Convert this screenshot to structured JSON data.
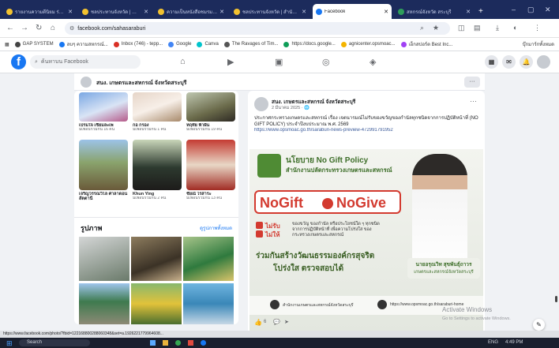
{
  "browser": {
    "tabs": [
      {
        "label": "รายงานความดีนิยม ร่วมขับเคลื่อน"
      },
      {
        "label": "ชลประทานจังหวัด | สำนักงานฯ"
      },
      {
        "label": "ความเป็นหนังสือชมรมสหกรณ์"
      },
      {
        "label": "ชลประทานจังหวัด | สำนักงานฯ"
      },
      {
        "label": "Facebook"
      },
      {
        "label": "สหกรณ์จังหวัด สระบุรี"
      }
    ],
    "new_tab_label": "+",
    "url": "facebook.com/sahasaraburi",
    "bookmarks": [
      {
        "label": "GAP SYSTEM"
      },
      {
        "label": "ลบๆ ความสหกรณ์..."
      },
      {
        "label": "Inbox (746) - tepp..."
      },
      {
        "label": "Google"
      },
      {
        "label": "Canva"
      },
      {
        "label": "The Ravages of Tim..."
      },
      {
        "label": "https://docs.google..."
      },
      {
        "label": "agnicenter.opsmoac..."
      },
      {
        "label": "เอ็กสปอร์ต Best Inc..."
      },
      {
        "label": "บุ๊กมาร์กทั้งหมด"
      }
    ]
  },
  "facebook": {
    "logo": "f",
    "search_placeholder": "ค้นหาบน Facebook"
  },
  "page_header": {
    "name": "สนง. เกษตรและสหกรณ์ จังหวัดสระบุรี",
    "more": "···"
  },
  "friends": [
    {
      "name": "เปรมใจ เชียมละเพ",
      "mutual": "มีเพื่อนร่วมกัน 16 คน"
    },
    {
      "name": "กอ กรอง",
      "mutual": "มีเพื่อนร่วมกัน 1 คน"
    },
    {
      "name": "หฤทัย ฟ้าฝัน",
      "mutual": "มีเพื่อนร่วมกัน 19 คน"
    },
    {
      "name": "เจริญวรรณวิไล ศาลาดอน สัตตานี",
      "mutual": ""
    },
    {
      "name": "Khun Ying",
      "mutual": "มีเพื่อนร่วมกัน 2 คน"
    },
    {
      "name": "ชัยณ์ ไรสาระ",
      "mutual": "มีเพื่อนร่วมกัน 13 คน"
    }
  ],
  "photos": {
    "title": "รูปภาพ",
    "see_all": "ดูรูปภาพทั้งหมด"
  },
  "post": {
    "author": "สนง. เกษตรและสหกรณ์ จังหวัดสระบุรี",
    "time": "2 มีนาคม 2025 · 🌐",
    "more": "···",
    "text": "ประกาศกระทรวงเกษตรและสหกรณ์ เรื่อง เจตนารมณ์ไม่รับของขวัญของกำนัลทุกชนิดจากการปฏิบัติหน้าที่ (NO GIFT POLICY) ประจำปีงบประมาณ พ.ศ. 2569",
    "link": "https://www.opsmoac.go.th/saraburi-news-preview-472991791952",
    "banner": {
      "title1": "นโยบาย No Gift Policy",
      "title2": "สำนักงานปลัดกระทรวงเกษตรและสหกรณ์",
      "no_gift_1": "NoGift",
      "no_gift_2": "NoGive",
      "no_receive": "ไม่รับ",
      "no_give": "ไม่ให้",
      "rule_text": "ของขวัญ ของกำนัล หรือประโยชน์ใด ๆ ทุกชนิด จากการปฏิบัติหน้าที่ เพื่อความโปร่งใส ของกระทรวงเกษตรและสหกรณ์",
      "slogan1": "ร่วมกันสร้างวัฒนธรรมองค์กรสุจริต",
      "slogan2": "โปร่งใส ตรวจสอบได้",
      "official_name": "นายอรุณวิท สุขพันธุ์ถาวร",
      "official_title": "เกษตรและสหกรณ์จังหวัดสระบุรี",
      "footer_left": "สำนักงานเกษตรและสหกรณ์จังหวัดสระบุรี",
      "footer_right": "https://www.opsmoac.go.th/saraburi-home"
    },
    "reaction_count": "6",
    "comment_icon": "💬"
  },
  "activation": {
    "title": "Activate Windows",
    "subtitle": "Go to Settings to activate Windows."
  },
  "status_url": "https://www.facebook.com/photo/?fbid=122168800288060348&set=a.1926221779964608...",
  "taskbar": {
    "search": "Search",
    "lang": "ENG",
    "time": "4:49 PM"
  },
  "colors": {
    "fb_blue": "#1877f2",
    "nogift_red": "#d33a2f",
    "banner_green": "#5b8c3a"
  }
}
